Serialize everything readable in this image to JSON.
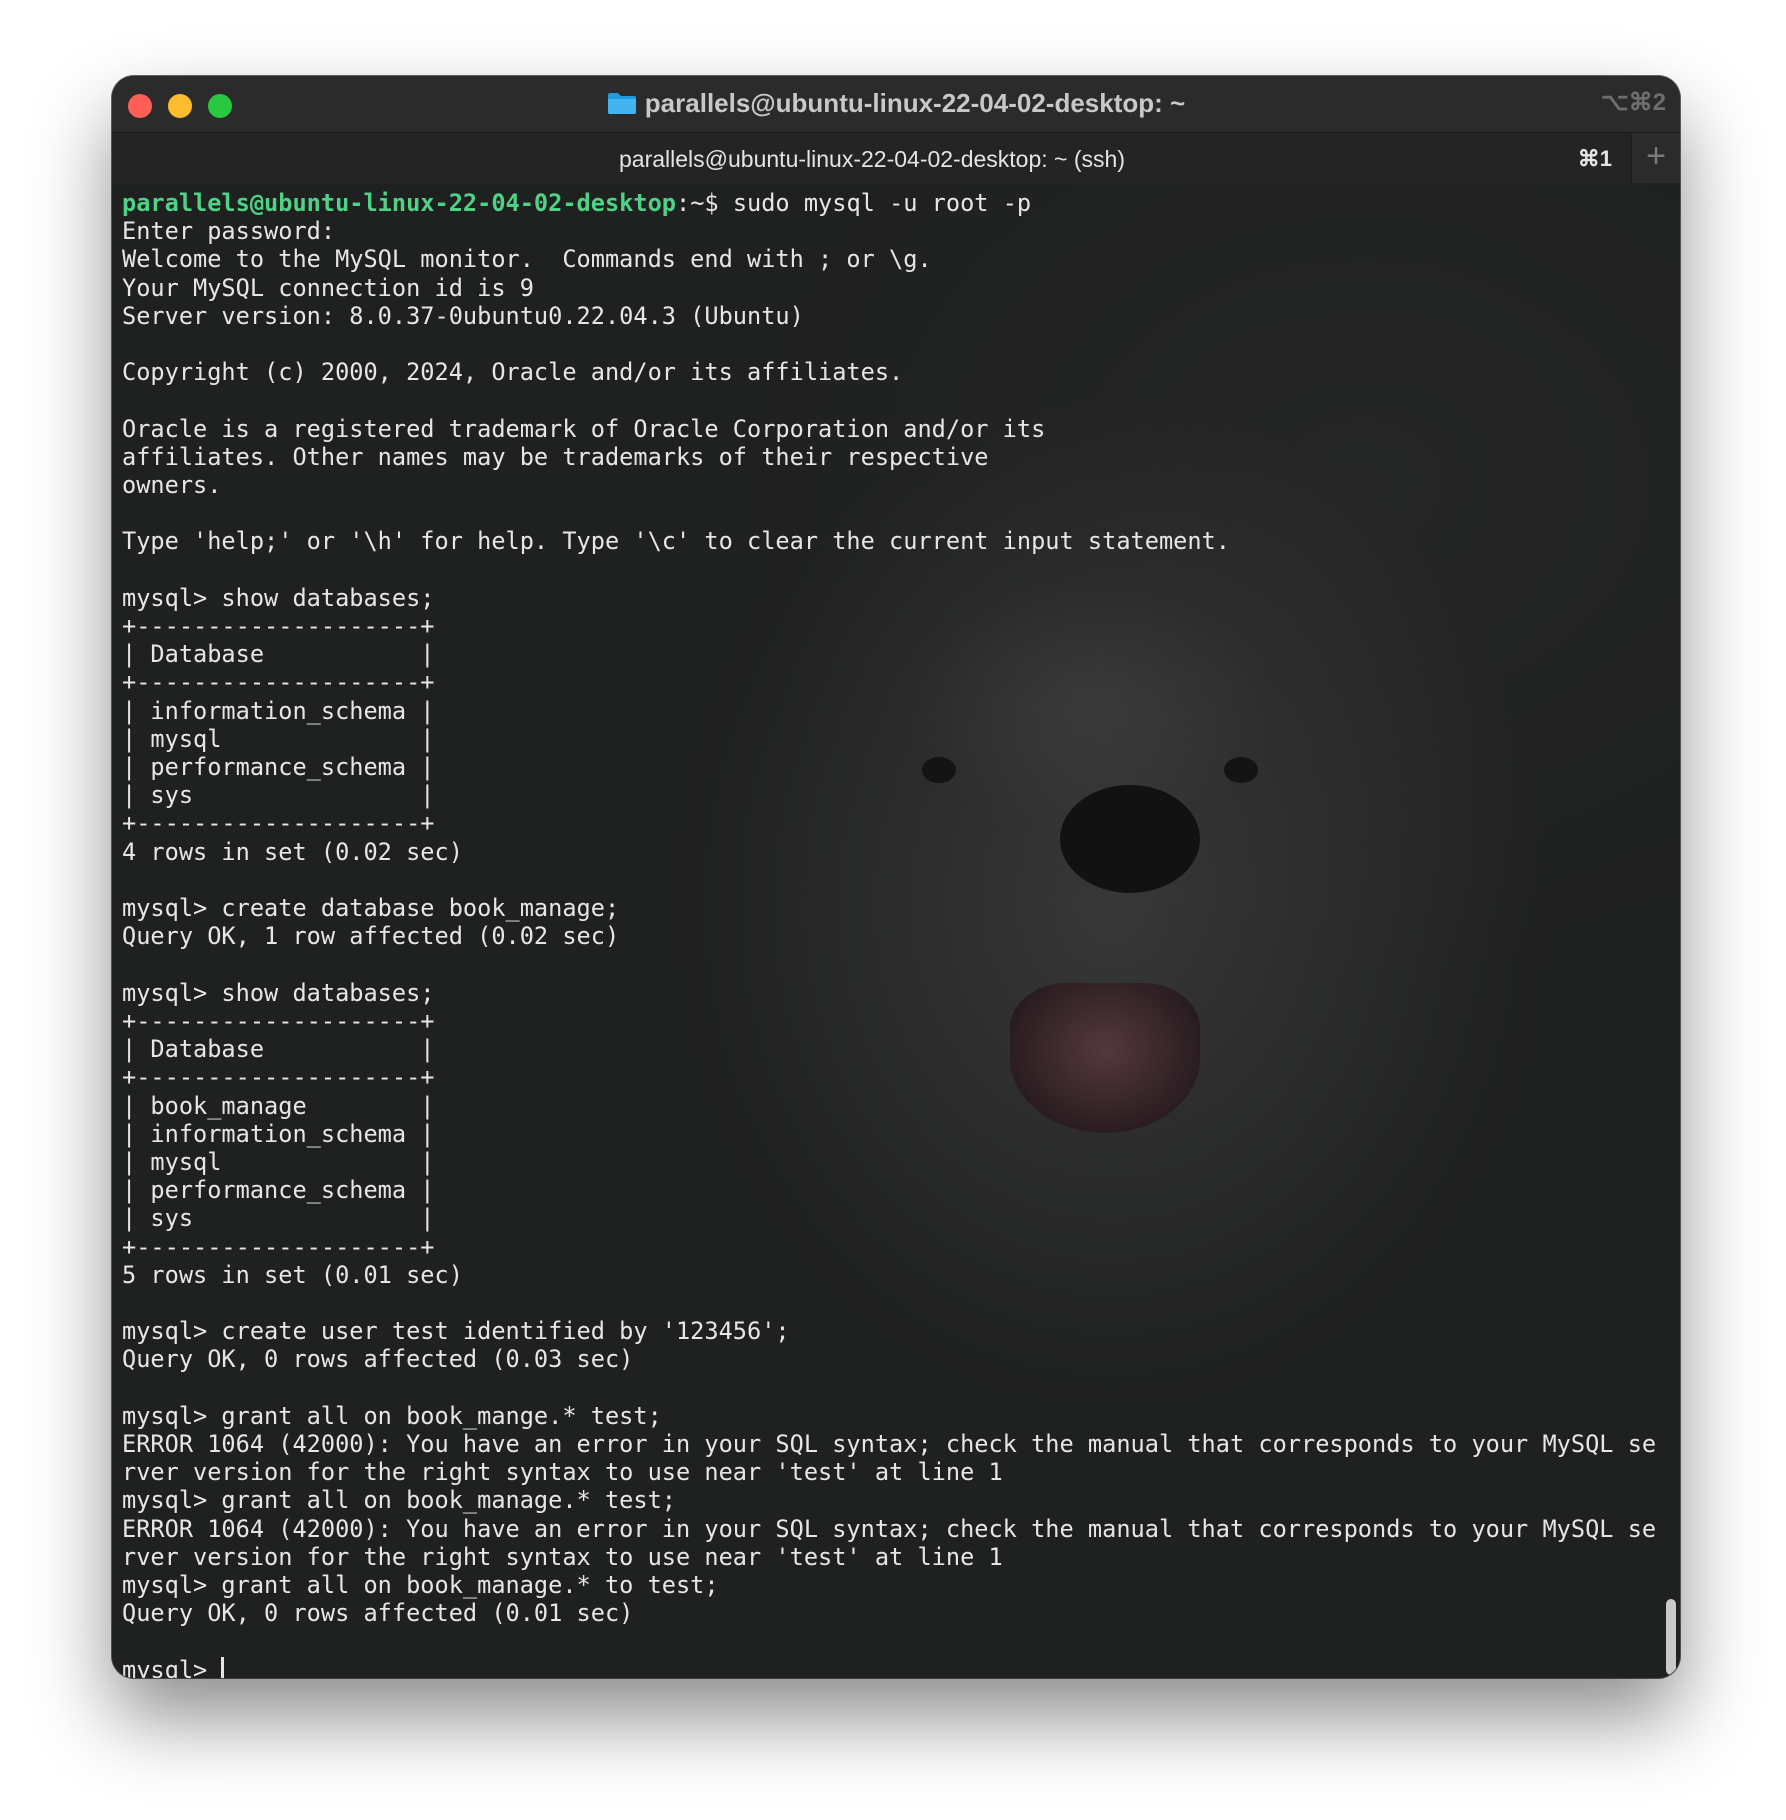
{
  "window": {
    "title": "parallels@ubuntu-linux-22-04-02-desktop: ~",
    "title_shortcut": "⌥⌘2"
  },
  "tab": {
    "label": "parallels@ubuntu-linux-22-04-02-desktop: ~ (ssh)",
    "shortcut": "⌘1",
    "new_tab_label": "+"
  },
  "terminal": {
    "prompt_user": "parallels@ubuntu-linux-22-04-02-desktop",
    "prompt_path": ":~$",
    "first_command": " sudo mysql -u root -p",
    "lines": [
      "Enter password:",
      "Welcome to the MySQL monitor.  Commands end with ; or \\g.",
      "Your MySQL connection id is 9",
      "Server version: 8.0.37-0ubuntu0.22.04.3 (Ubuntu)",
      "",
      "Copyright (c) 2000, 2024, Oracle and/or its affiliates.",
      "",
      "Oracle is a registered trademark of Oracle Corporation and/or its",
      "affiliates. Other names may be trademarks of their respective",
      "owners.",
      "",
      "Type 'help;' or '\\h' for help. Type '\\c' to clear the current input statement.",
      "",
      "mysql> show databases;",
      "+--------------------+",
      "| Database           |",
      "+--------------------+",
      "| information_schema |",
      "| mysql              |",
      "| performance_schema |",
      "| sys                |",
      "+--------------------+",
      "4 rows in set (0.02 sec)",
      "",
      "mysql> create database book_manage;",
      "Query OK, 1 row affected (0.02 sec)",
      "",
      "mysql> show databases;",
      "+--------------------+",
      "| Database           |",
      "+--------------------+",
      "| book_manage        |",
      "| information_schema |",
      "| mysql              |",
      "| performance_schema |",
      "| sys                |",
      "+--------------------+",
      "5 rows in set (0.01 sec)",
      "",
      "mysql> create user test identified by '123456';",
      "Query OK, 0 rows affected (0.03 sec)",
      "",
      "mysql> grant all on book_mange.* test;",
      "ERROR 1064 (42000): You have an error in your SQL syntax; check the manual that corresponds to your MySQL se",
      "rver version for the right syntax to use near 'test' at line 1",
      "mysql> grant all on book_manage.* test;",
      "ERROR 1064 (42000): You have an error in your SQL syntax; check the manual that corresponds to your MySQL se",
      "rver version for the right syntax to use near 'test' at line 1",
      "mysql> grant all on book_manage.* to test;",
      "Query OK, 0 rows affected (0.01 sec)",
      ""
    ],
    "current_prompt": "mysql> "
  },
  "colors": {
    "prompt_user": "#4fd186",
    "text": "#e6e6e6",
    "close": "#ff5f57",
    "minimize": "#febc2e",
    "maximize": "#28c840"
  }
}
